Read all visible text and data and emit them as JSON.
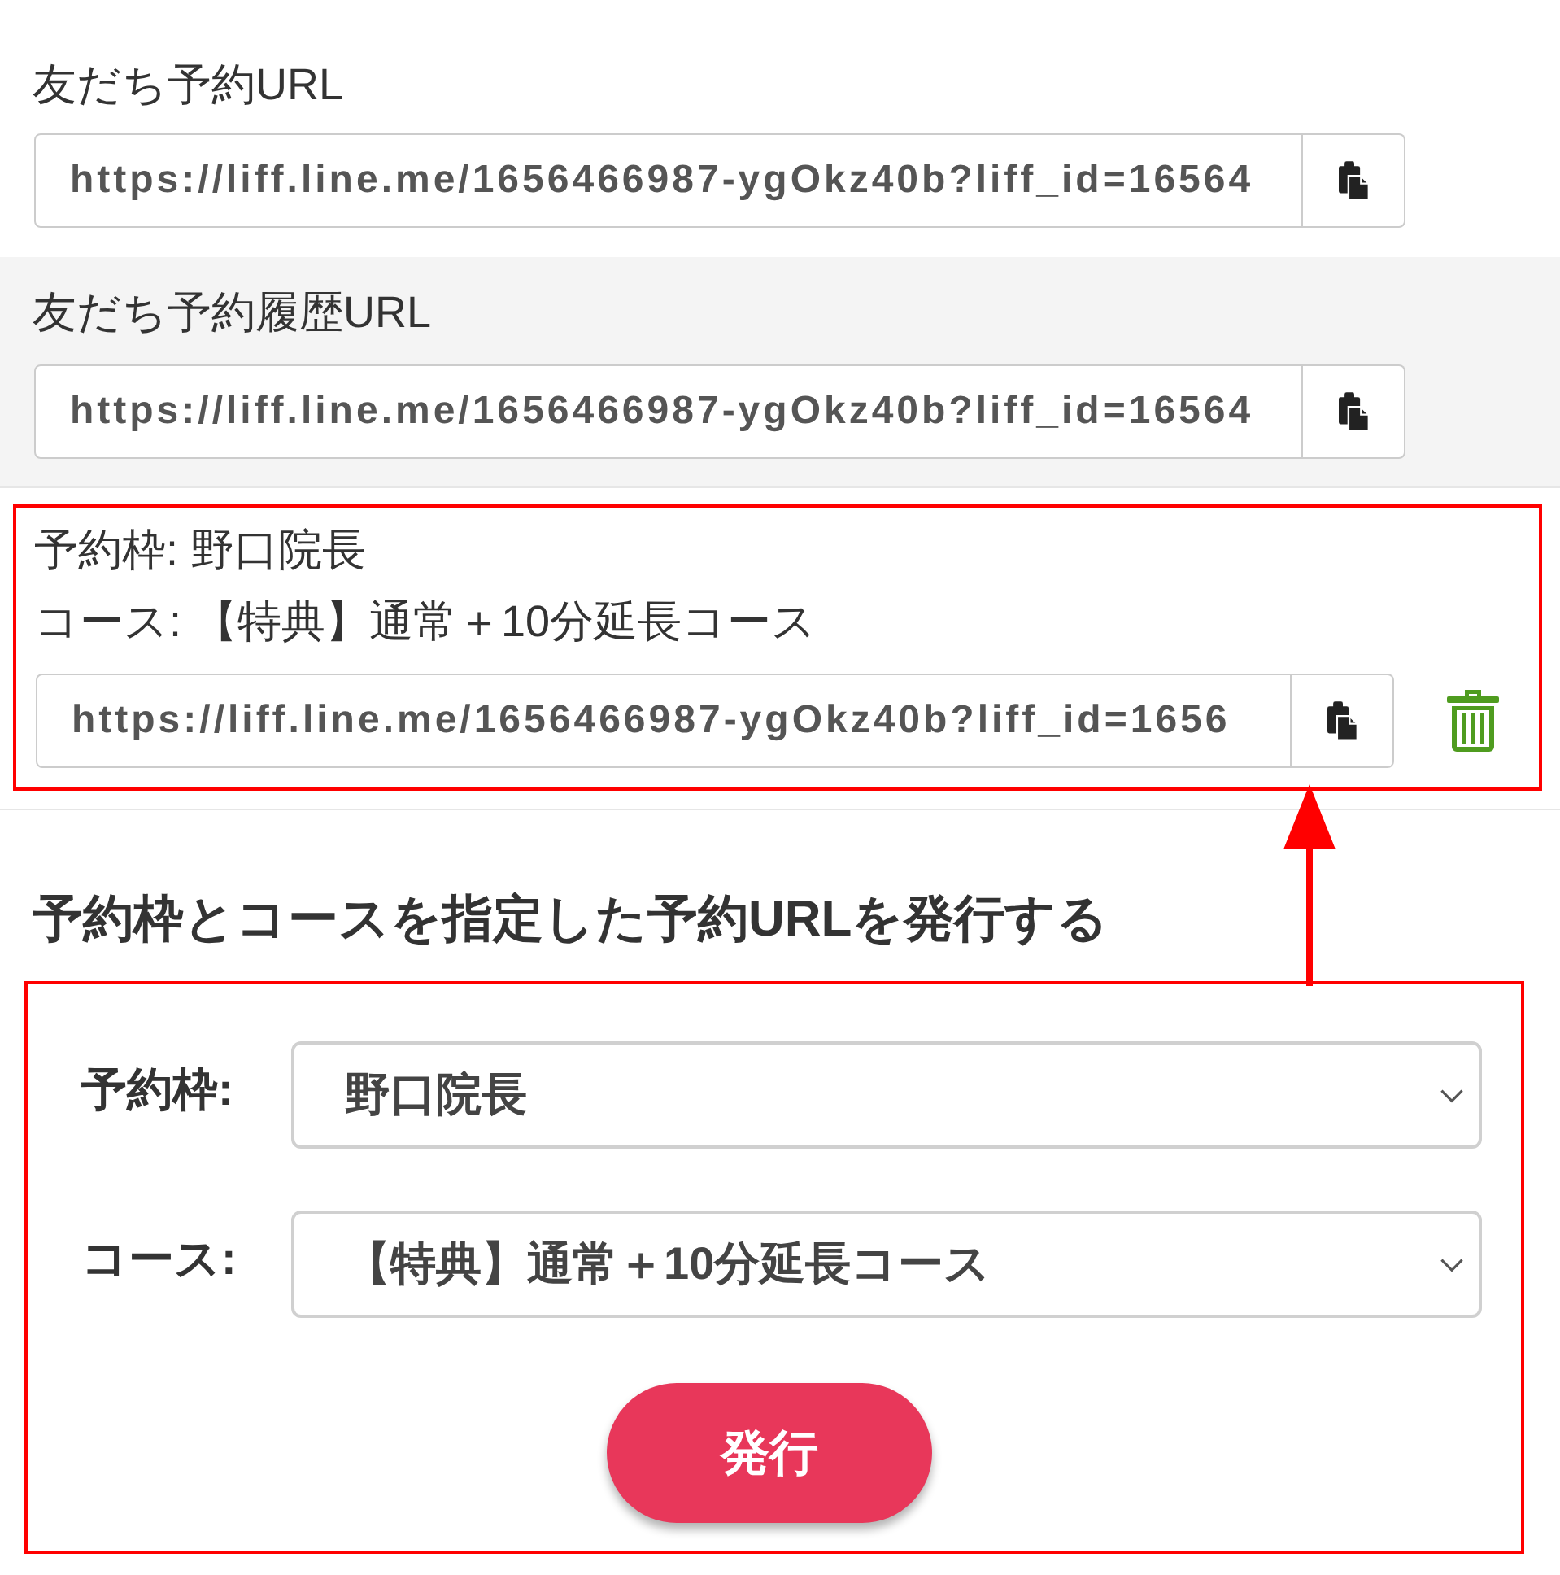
{
  "url_sections": [
    {
      "label": "友だち予約URL",
      "url": "https://liff.line.me/1656466987-ygOkz40b?liff_id=16564",
      "shaded": false
    },
    {
      "label": "友だち予約履歴URL",
      "url": "https://liff.line.me/1656466987-ygOkz40b?liff_id=16564",
      "shaded": true
    }
  ],
  "issued_urls": [
    {
      "lines": [
        "予約枠: 野口院長",
        "コース: 【特典】通常＋10分延長コース"
      ],
      "url": "https://liff.line.me/1656466987-ygOkz40b?liff_id=1656",
      "annotated": true
    }
  ],
  "issue_form": {
    "title": "予約枠とコースを指定した予約URLを発行する",
    "annotated": true,
    "fields": [
      {
        "label": "予約枠:",
        "value": "野口院長"
      },
      {
        "label": "コース:",
        "value": "【特典】通常＋10分延長コース"
      }
    ],
    "button": "発行"
  },
  "callout_arrow": true
}
